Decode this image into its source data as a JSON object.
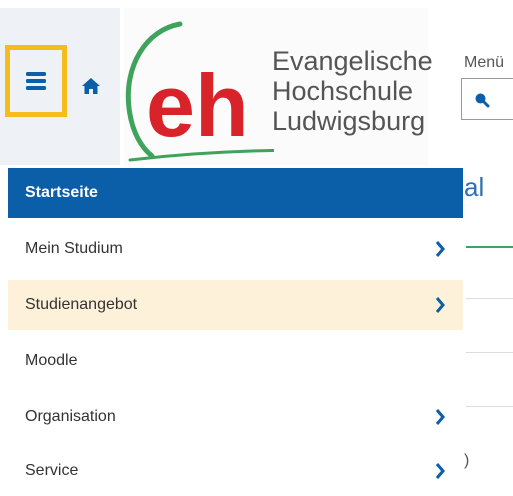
{
  "header": {
    "menu_toggle": "menu-hamburger-icon",
    "home": "home-icon",
    "logo": {
      "mark": "eh",
      "line1": "Evangelische",
      "line2": "Hochschule",
      "line3": "Ludwigsburg"
    },
    "search": {
      "label": "Menü"
    }
  },
  "background": {
    "title_fragment": "al",
    "trailing_char": ")"
  },
  "nav": {
    "items": [
      {
        "label": "Startseite",
        "active": true,
        "has_submenu": false
      },
      {
        "label": "Mein Studium",
        "has_submenu": true
      },
      {
        "label": "Studienangebot",
        "has_submenu": true,
        "highlighted": true
      },
      {
        "label": "Moodle",
        "has_submenu": false
      },
      {
        "label": "Organisation",
        "has_submenu": true
      },
      {
        "label": "Service",
        "has_submenu": true
      }
    ]
  },
  "colors": {
    "accent_blue": "#0b5ea8",
    "focus_yellow": "#f4bd1b",
    "hover_bg": "#fdf1d9",
    "logo_red": "#d8232a",
    "logo_green": "#3ea35b"
  }
}
